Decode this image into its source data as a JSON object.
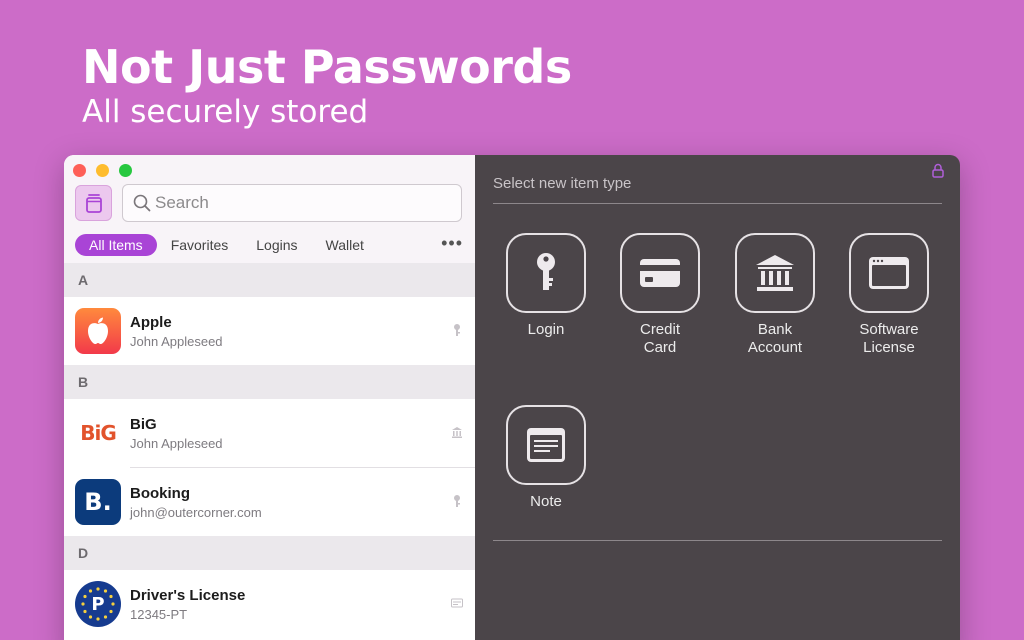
{
  "hero": {
    "headline": "Not Just Passwords",
    "subheadline": "All securely stored"
  },
  "colors": {
    "background": "#cc6cc8",
    "accent": "#a944d6",
    "right_pane": "#4b4549"
  },
  "search": {
    "placeholder": "Search"
  },
  "filters": [
    "All Items",
    "Favorites",
    "Logins",
    "Wallet"
  ],
  "filters_active": "All Items",
  "more_label": "•••",
  "list": {
    "sections": [
      "A",
      "B",
      "D"
    ],
    "items": [
      {
        "title": "Apple",
        "subtitle": "John Appleseed",
        "icon": "apple-logo-icon",
        "kind": "key-icon"
      },
      {
        "title": "BiG",
        "subtitle": "John Appleseed",
        "icon": "big-logo-icon",
        "logo_text": "BiG",
        "kind": "bank-icon"
      },
      {
        "title": "Booking",
        "subtitle": "john@outercorner.com",
        "icon": "booking-logo-icon",
        "logo_text": "B.",
        "kind": "key-icon"
      },
      {
        "title": "Driver's License",
        "subtitle": "12345-PT",
        "icon": "eu-license-icon",
        "logo_text": "P",
        "kind": "card-icon"
      }
    ]
  },
  "new_item": {
    "title": "Select new item type",
    "types": [
      {
        "label_line1": "Login",
        "label_line2": "",
        "icon": "key-icon"
      },
      {
        "label_line1": "Credit",
        "label_line2": "Card",
        "icon": "credit-card-icon"
      },
      {
        "label_line1": "Bank",
        "label_line2": "Account",
        "icon": "bank-icon"
      },
      {
        "label_line1": "Software",
        "label_line2": "License",
        "icon": "window-icon"
      },
      {
        "label_line1": "Note",
        "label_line2": "",
        "icon": "note-icon"
      }
    ]
  }
}
